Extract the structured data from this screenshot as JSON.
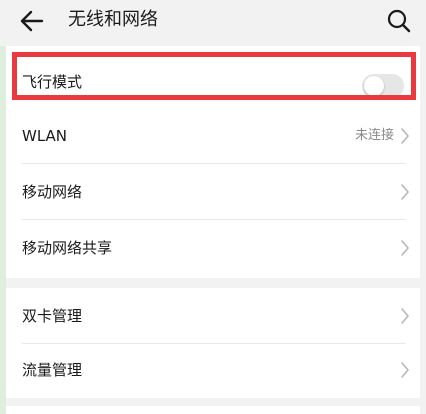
{
  "header": {
    "title": "无线和网络"
  },
  "sections": [
    {
      "items": [
        {
          "label": "飞行模式",
          "type": "toggle",
          "toggle_on": false
        },
        {
          "label": "WLAN",
          "type": "link",
          "status": "未连接"
        },
        {
          "label": "移动网络",
          "type": "link"
        },
        {
          "label": "移动网络共享",
          "type": "link"
        }
      ]
    },
    {
      "items": [
        {
          "label": "双卡管理",
          "type": "link"
        },
        {
          "label": "流量管理",
          "type": "link"
        }
      ]
    }
  ],
  "colors": {
    "background": "#f2f2f2",
    "card": "#ffffff",
    "highlight_border": "#e83a3f",
    "toggle_off": "#e6e6e6",
    "chevron": "#b8b8b8",
    "left_strip": "#dfeedd"
  },
  "icons": {
    "back": "back-arrow-icon",
    "search": "search-icon",
    "chevron": "chevron-right-icon"
  }
}
